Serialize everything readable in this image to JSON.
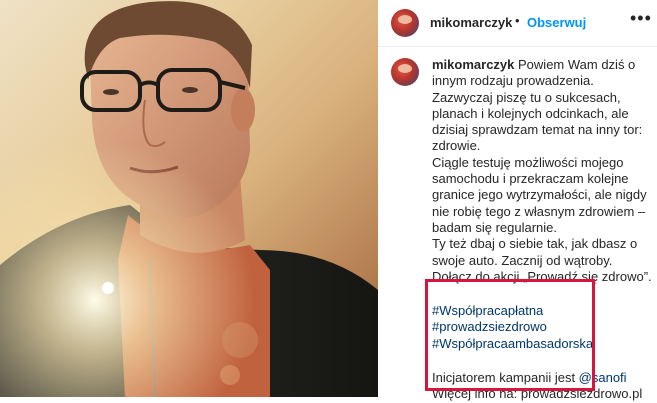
{
  "post": {
    "username": "mikomarczyk",
    "separator": "•",
    "follow_label": "Obserwuj",
    "more_icon": "•••",
    "caption_username": "mikomarczyk",
    "caption_lines": [
      "Powiem Wam dziś o",
      "innym rodzaju prowadzenia.",
      "Zazwyczaj piszę tu o sukcesach,",
      "planach i kolejnych odcinkach, ale",
      "dzisiaj sprawdzam temat na inny tor:",
      "zdrowie.",
      "Ciągle testuję możliwości mojego",
      "samochodu i przekraczam kolejne",
      "granice jego wytrzymałości, ale nigdy",
      "nie robię tego z własnym zdrowiem –",
      "badam się regularnie.",
      "Ty też dbaj o siebie tak, jak dbasz o",
      "swoje auto. Zacznij od wątroby.",
      "Dołącz do akcji „Prowadź się zdrowo”."
    ],
    "hashtags": [
      "#Współpracapłatna",
      "#prowadzsiezdrowo",
      "#Współpracaambasadorska"
    ],
    "footer_line1_prefix": "Inicjatorem kampanii jest ",
    "footer_mention": "@sanofi",
    "footer_line2": "Więcej info na: prowadzsiezdrowo.pl"
  },
  "colors": {
    "link": "#0095f6",
    "highlight": "#d6163e",
    "hashtag": "#00376b"
  }
}
